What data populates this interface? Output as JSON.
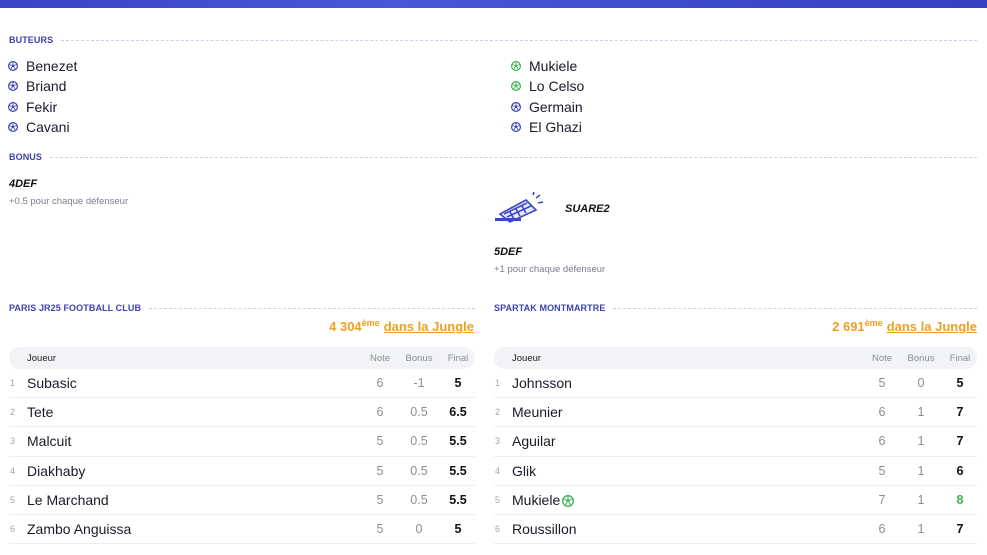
{
  "buteurs": {
    "title": "BUTEURS",
    "left": [
      "Benezet",
      "Briand",
      "Fekir",
      "Cavani"
    ],
    "right": [
      {
        "name": "Mukiele",
        "type": "green"
      },
      {
        "name": "Lo Celso",
        "type": "green"
      },
      {
        "name": "Germain",
        "type": "blue"
      },
      {
        "name": "El Ghazi",
        "type": "blue"
      }
    ]
  },
  "bonus": {
    "title": "BONUS",
    "left": {
      "name": "4DEF",
      "desc": "+0.5 pour chaque défenseur"
    },
    "right_extra": {
      "name": "SUARE2"
    },
    "right": {
      "name": "5DEF",
      "desc": "+1 pour chaque défenseur"
    }
  },
  "colors": {
    "accent": "#3b44b0",
    "rank": "#f0a020",
    "green": "#3fb34f"
  },
  "teams": [
    {
      "name": "PARIS JR25 FOOTBALL CLUB",
      "rank": "4 304",
      "rank_sup": "ème",
      "rank_suffix": "dans la Jungle",
      "headers": {
        "player": "Joueur",
        "note": "Note",
        "bonus": "Bonus",
        "final": "Final"
      },
      "rows": [
        {
          "idx": "1",
          "name": "Subasic",
          "note": "6",
          "bonus": "-1",
          "final": "5"
        },
        {
          "idx": "2",
          "name": "Tete",
          "note": "6",
          "bonus": "0.5",
          "final": "6.5"
        },
        {
          "idx": "3",
          "name": "Malcuit",
          "note": "5",
          "bonus": "0.5",
          "final": "5.5"
        },
        {
          "idx": "4",
          "name": "Diakhaby",
          "note": "5",
          "bonus": "0.5",
          "final": "5.5"
        },
        {
          "idx": "5",
          "name": "Le Marchand",
          "note": "5",
          "bonus": "0.5",
          "final": "5.5"
        },
        {
          "idx": "6",
          "name": "Zambo Anguissa",
          "note": "5",
          "bonus": "0",
          "final": "5"
        }
      ]
    },
    {
      "name": "SPARTAK MONTMARTRE",
      "rank": "2 691",
      "rank_sup": "ème",
      "rank_suffix": "dans la Jungle",
      "headers": {
        "player": "Joueur",
        "note": "Note",
        "bonus": "Bonus",
        "final": "Final"
      },
      "rows": [
        {
          "idx": "1",
          "name": "Johnsson",
          "note": "5",
          "bonus": "0",
          "final": "5"
        },
        {
          "idx": "2",
          "name": "Meunier",
          "note": "6",
          "bonus": "1",
          "final": "7"
        },
        {
          "idx": "3",
          "name": "Aguilar",
          "note": "6",
          "bonus": "1",
          "final": "7"
        },
        {
          "idx": "4",
          "name": "Glik",
          "note": "5",
          "bonus": "1",
          "final": "6"
        },
        {
          "idx": "5",
          "name": "Mukiele",
          "note": "7",
          "bonus": "1",
          "final": "8",
          "goal": true
        },
        {
          "idx": "6",
          "name": "Roussillon",
          "note": "6",
          "bonus": "1",
          "final": "7"
        }
      ]
    }
  ]
}
